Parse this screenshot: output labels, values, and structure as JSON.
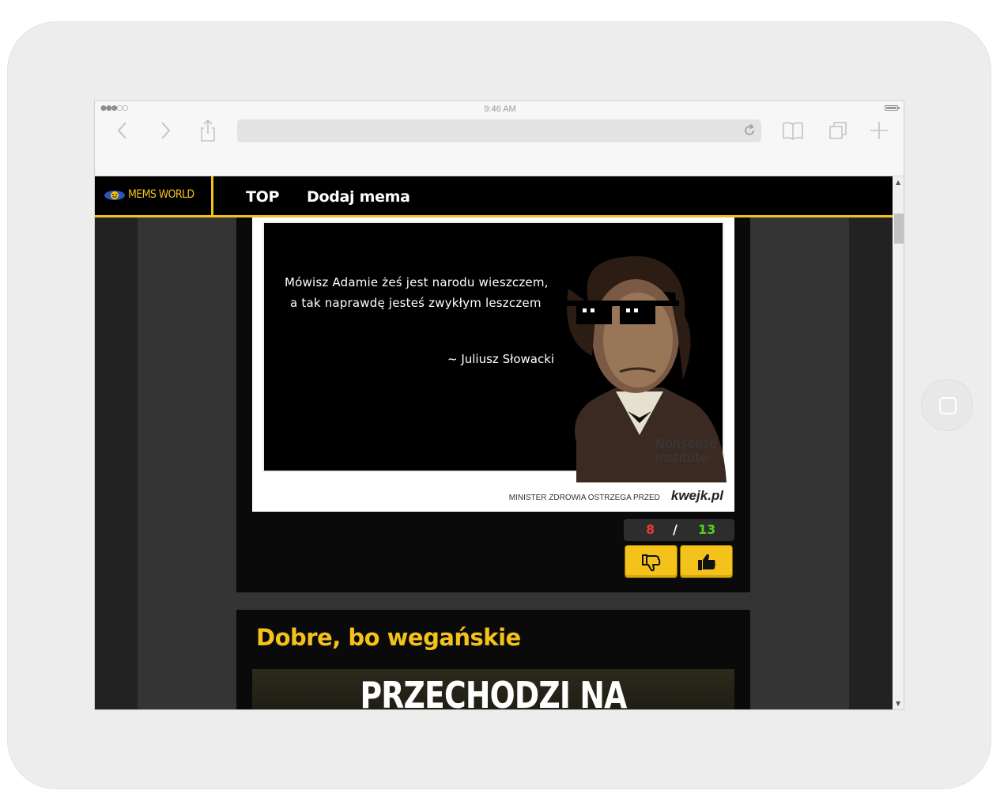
{
  "status": {
    "signal": "●●●○○",
    "time": "9:46 AM"
  },
  "browser": {
    "icons": [
      "back-icon",
      "forward-icon",
      "share-icon",
      "reload-icon",
      "bookmarks-icon",
      "tabs-icon",
      "new-tab-icon"
    ],
    "url": ""
  },
  "site": {
    "logo": "MEMS WORLD",
    "nav": {
      "top": "TOP",
      "add": "Dodaj mema"
    },
    "colors": {
      "accent": "#f5c21b",
      "down": "#e63b2e",
      "up": "#4ed21e"
    }
  },
  "post1": {
    "meme_quote_1": "Mówisz Adamie żeś jest narodu wieszczem,",
    "meme_quote_2": "a tak naprawdę jesteś zwykłym leszczem",
    "meme_author": "~ Juliusz Słowacki",
    "meme_footer": "MINISTER ZDROWIA OSTRZEGA PRZED",
    "meme_brand": "kwejk.pl",
    "watermark": "Nonsense Institute",
    "votes_down": "8",
    "votes_sep": "/",
    "votes_up": "13"
  },
  "post2": {
    "title": "Dobre, bo wegańskie",
    "meme_text": "PRZECHODZI NA"
  }
}
